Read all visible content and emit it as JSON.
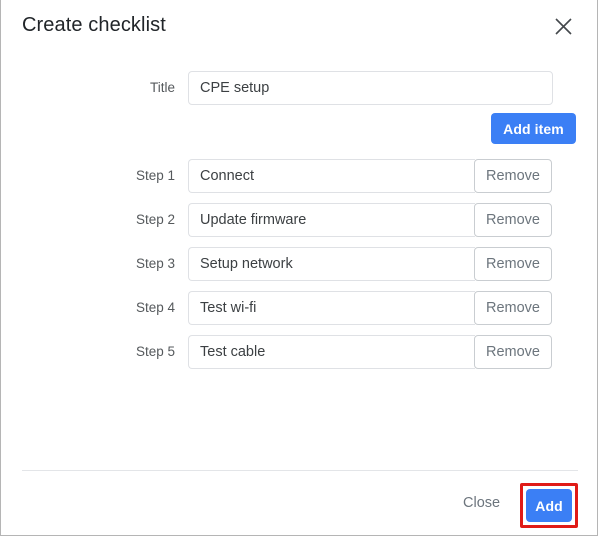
{
  "dialog": {
    "title": "Create checklist",
    "close_icon": "close-icon"
  },
  "form": {
    "title_label": "Title",
    "title_value": "CPE setup",
    "title_placeholder": "",
    "add_item_label": "Add item",
    "remove_label": "Remove",
    "steps": [
      {
        "label": "Step 1",
        "value": "Connect",
        "remove": "Remove"
      },
      {
        "label": "Step 2",
        "value": "Update firmware",
        "remove": "Remove"
      },
      {
        "label": "Step 3",
        "value": "Setup network",
        "remove": "Remove"
      },
      {
        "label": "Step 4",
        "value": "Test wi-fi",
        "remove": "Remove"
      },
      {
        "label": "Step 5",
        "value": "Test cable",
        "remove": "Remove"
      }
    ]
  },
  "footer": {
    "close_label": "Close",
    "add_label": "Add"
  },
  "colors": {
    "primary_blue": "#3b7ff5",
    "highlight_red": "#e01b17",
    "input_border": "#dfe1e5",
    "button_border": "#c9cdd1",
    "label_text": "#55595c",
    "title_text": "#212529",
    "muted_text": "#6c757d"
  }
}
